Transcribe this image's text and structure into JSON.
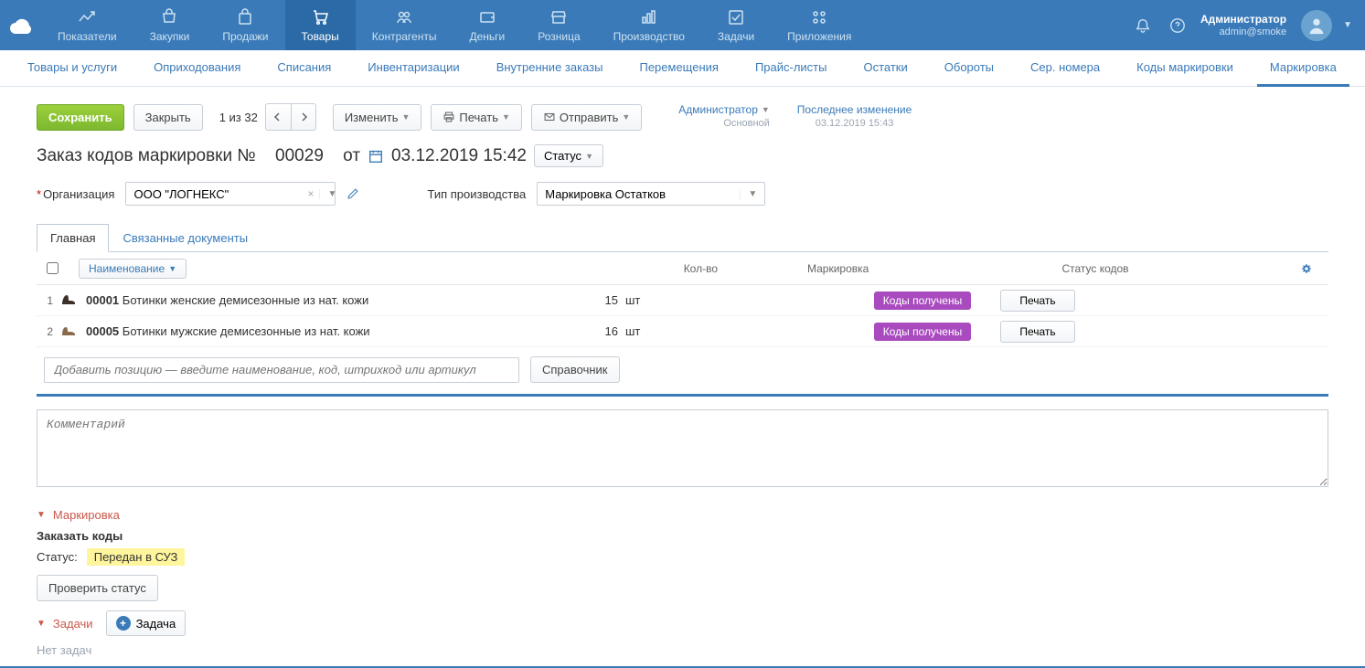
{
  "top_nav": {
    "items": [
      {
        "label": "Показатели"
      },
      {
        "label": "Закупки"
      },
      {
        "label": "Продажи"
      },
      {
        "label": "Товары",
        "active": true
      },
      {
        "label": "Контрагенты"
      },
      {
        "label": "Деньги"
      },
      {
        "label": "Розница"
      },
      {
        "label": "Производство"
      },
      {
        "label": "Задачи"
      },
      {
        "label": "Приложения"
      }
    ],
    "user_name": "Администратор",
    "user_login": "admin@smoke"
  },
  "sub_nav": {
    "items": [
      {
        "label": "Товары и услуги"
      },
      {
        "label": "Оприходования"
      },
      {
        "label": "Списания"
      },
      {
        "label": "Инвентаризации"
      },
      {
        "label": "Внутренние заказы"
      },
      {
        "label": "Перемещения"
      },
      {
        "label": "Прайс-листы"
      },
      {
        "label": "Остатки"
      },
      {
        "label": "Обороты"
      },
      {
        "label": "Сер. номера"
      },
      {
        "label": "Коды маркировки"
      },
      {
        "label": "Маркировка",
        "active": true
      }
    ]
  },
  "toolbar": {
    "save": "Сохранить",
    "close": "Закрыть",
    "pager": "1 из 32",
    "change": "Изменить",
    "print": "Печать",
    "send": "Отправить"
  },
  "meta": {
    "owner_label": "Администратор",
    "owner_sub": "Основной",
    "changed_label": "Последнее изменение",
    "changed_sub": "03.12.2019 15:43"
  },
  "title": {
    "prefix": "Заказ кодов маркировки №",
    "num": "00029",
    "from": "от",
    "datetime": "03.12.2019 15:42",
    "status_btn": "Статус"
  },
  "form": {
    "org_label": "Организация",
    "org_value": "ООО \"ЛОГНЕКС\"",
    "prod_type_label": "Тип производства",
    "prod_type_value": "Маркировка Остатков"
  },
  "tabs": {
    "main": "Главная",
    "linked": "Связанные документы"
  },
  "table": {
    "name_hdr": "Наименование",
    "qty_hdr": "Кол-во",
    "mark_hdr": "Маркировка",
    "status_hdr": "Статус кодов",
    "rows": [
      {
        "n": "1",
        "code": "00001",
        "name": "Ботинки женские демисезонные из нат. кожи",
        "qty": "15",
        "unit": "шт",
        "status": "Коды получены",
        "print": "Печать"
      },
      {
        "n": "2",
        "code": "00005",
        "name": "Ботинки мужские демисезонные из нат. кожи",
        "qty": "16",
        "unit": "шт",
        "status": "Коды получены",
        "print": "Печать"
      }
    ],
    "add_placeholder": "Добавить позицию — введите наименование, код, штрихкод или артикул",
    "catalog_btn": "Справочник"
  },
  "comment_placeholder": "Комментарий",
  "marking": {
    "hdr": "Маркировка",
    "order_label": "Заказать коды",
    "status_label": "Статус:",
    "status_value": "Передан в СУЗ",
    "check_btn": "Проверить статус"
  },
  "tasks": {
    "hdr": "Задачи",
    "add_btn": "Задача",
    "none": "Нет задач"
  }
}
